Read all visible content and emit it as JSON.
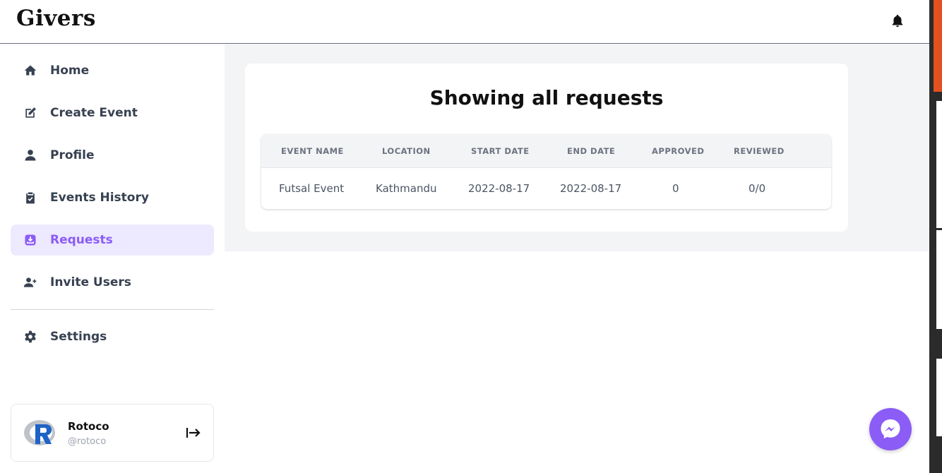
{
  "header": {
    "logo": "Givers",
    "notification_icon": "bell-icon"
  },
  "sidebar": {
    "items": [
      {
        "label": "Home",
        "icon": "home-icon"
      },
      {
        "label": "Create Event",
        "icon": "edit-icon"
      },
      {
        "label": "Profile",
        "icon": "user-icon"
      },
      {
        "label": "Events History",
        "icon": "clipboard-check-icon"
      },
      {
        "label": "Requests",
        "icon": "inbox-download-icon",
        "active": true
      },
      {
        "label": "Invite Users",
        "icon": "user-plus-icon"
      },
      {
        "label": "Settings",
        "icon": "gear-icon"
      }
    ],
    "user": {
      "name": "Rotoco",
      "handle": "@rotoco",
      "logout_icon": "logout-icon"
    }
  },
  "main": {
    "title": "Showing all requests",
    "table": {
      "headers": [
        "EVENT NAME",
        "LOCATION",
        "START DATE",
        "END DATE",
        "APPROVED",
        "REVIEWED"
      ],
      "rows": [
        [
          "Futsal Event",
          "Kathmandu",
          "2022-08-17",
          "2022-08-17",
          "0",
          "0/0"
        ]
      ]
    }
  },
  "widgets": {
    "messenger_icon": "messenger-icon"
  },
  "colors": {
    "accent": "#8b5cf6",
    "active_bg": "#ede9fe",
    "main_bg": "#f3f4f6"
  }
}
